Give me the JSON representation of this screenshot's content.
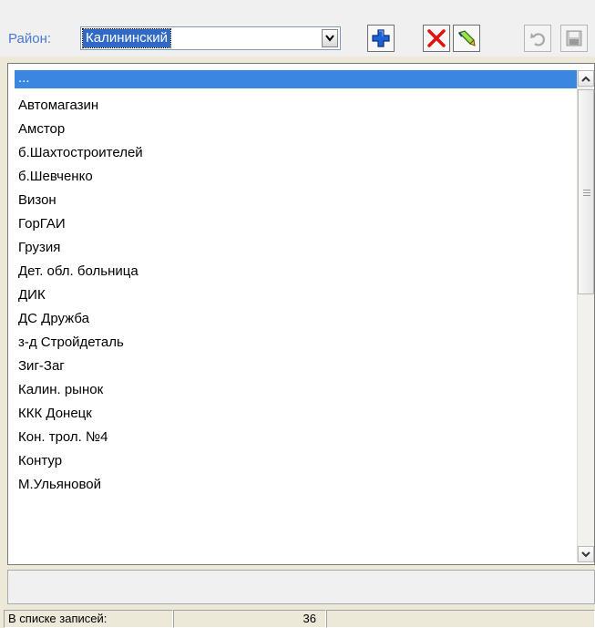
{
  "toolbar": {
    "district_label": "Район:",
    "district_value": "Калининский"
  },
  "list": {
    "items": [
      "...",
      "Автомагазин",
      "Амстор",
      "б.Шахтостроителей",
      "б.Шевченко",
      "Визон",
      "ГорГАИ",
      "Грузия",
      "Дет. обл. больница",
      "ДИК",
      "ДС Дружба",
      "з-д Стройдеталь",
      "Зиг-Заг",
      "Калин. рынок",
      "ККК Донецк",
      "Кон. трол. №4",
      "Контур",
      "М.Ульяновой"
    ],
    "selected_index": 0
  },
  "status": {
    "records_label": "В списке записей:",
    "records_count": "36"
  },
  "icons": {
    "add": "plus-icon",
    "delete": "red-x-icon",
    "edit": "pencil-icon",
    "undo": "undo-icon",
    "save": "floppy-disk-icon"
  },
  "colors": {
    "selection": "#3a86e1",
    "label": "#4a78d6",
    "delete": "#e01010"
  }
}
